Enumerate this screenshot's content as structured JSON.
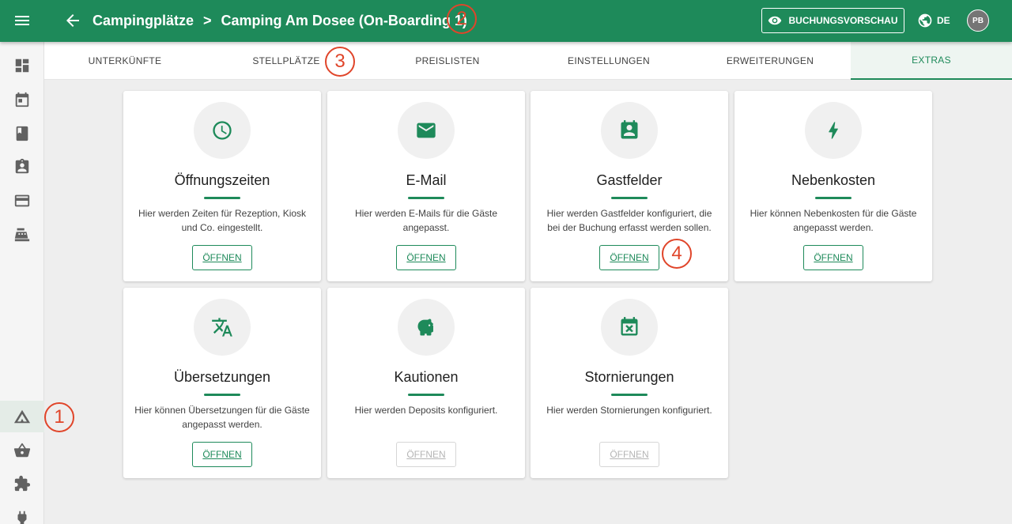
{
  "header": {
    "breadcrumb_root": "Campingplätze",
    "breadcrumb_separator": ">",
    "breadcrumb_current": "Camping Am Dosee (On-Boarding 1)",
    "preview_label": "BUCHUNGSVORSCHAU",
    "language": "DE",
    "avatar_initials": "PB",
    "accent_color": "#1e8a5a"
  },
  "sidebar": {
    "items": [
      {
        "icon": "dashboard-icon"
      },
      {
        "icon": "calendar-icon"
      },
      {
        "icon": "book-icon"
      },
      {
        "icon": "contact-card-icon"
      },
      {
        "icon": "credit-card-icon"
      },
      {
        "icon": "cash-register-icon"
      },
      {
        "icon": "tent-icon",
        "active": true
      },
      {
        "icon": "shopping-basket-icon"
      },
      {
        "icon": "puzzle-icon"
      },
      {
        "icon": "plug-icon"
      }
    ]
  },
  "tabs": [
    "UNTERKÜNFTE",
    "STELLPLÄTZE",
    "PREISLISTEN",
    "EINSTELLUNGEN",
    "ERWEITERUNGEN",
    "EXTRAS"
  ],
  "active_tab": "EXTRAS",
  "cards": [
    {
      "icon": "clock-icon",
      "title": "Öffnungszeiten",
      "description": "Hier werden Zeiten für Rezeption, Kiosk und Co. eingestellt.",
      "button": "ÖFFNEN",
      "enabled": true
    },
    {
      "icon": "mail-icon",
      "title": "E-Mail",
      "description": "Hier werden E-Mails für die Gäste angepasst.",
      "button": "ÖFFNEN",
      "enabled": true
    },
    {
      "icon": "guest-badge-icon",
      "title": "Gastfelder",
      "description": "Hier werden Gastfelder konfiguriert, die bei der Buchung erfasst werden sollen.",
      "button": "ÖFFNEN",
      "enabled": true
    },
    {
      "icon": "lightning-icon",
      "title": "Nebenkosten",
      "description": "Hier können Nebenkosten für die Gäste angepasst werden.",
      "button": "ÖFFNEN",
      "enabled": true
    },
    {
      "icon": "translate-icon",
      "title": "Übersetzungen",
      "description": "Hier können Übersetzungen für die Gäste angepasst werden.",
      "button": "ÖFFNEN",
      "enabled": true
    },
    {
      "icon": "piggy-bank-icon",
      "title": "Kautionen",
      "description": "Hier werden Deposits konfiguriert.",
      "button": "ÖFFNEN",
      "enabled": false
    },
    {
      "icon": "calendar-cancel-icon",
      "title": "Stornierungen",
      "description": "Hier werden Stornierungen konfiguriert.",
      "button": "ÖFFNEN",
      "enabled": false
    }
  ],
  "annotations": [
    "1",
    "2",
    "3",
    "4"
  ]
}
